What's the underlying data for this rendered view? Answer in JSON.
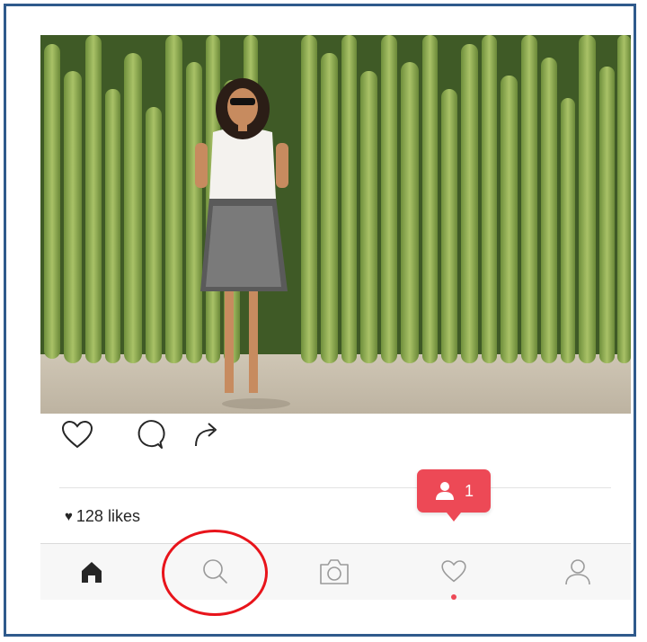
{
  "post": {
    "likes_text": "128 likes",
    "icons": [
      "like-heart-icon",
      "comment-icon",
      "share-arrow-icon"
    ]
  },
  "notification": {
    "count": "1",
    "icon": "follower-person-icon",
    "color": "#ed4956"
  },
  "tabbar": {
    "items": [
      {
        "icon": "home-icon",
        "active": true
      },
      {
        "icon": "search-icon",
        "active": false
      },
      {
        "icon": "camera-icon",
        "active": false
      },
      {
        "icon": "activity-heart-icon",
        "active": false,
        "has_dot": true
      },
      {
        "icon": "profile-icon",
        "active": false
      }
    ]
  },
  "annotation": {
    "color": "#e8141b",
    "target": "search-icon"
  },
  "colors": {
    "frame_border": "#2f5a8c",
    "accent": "#ed4956",
    "text": "#262626"
  }
}
